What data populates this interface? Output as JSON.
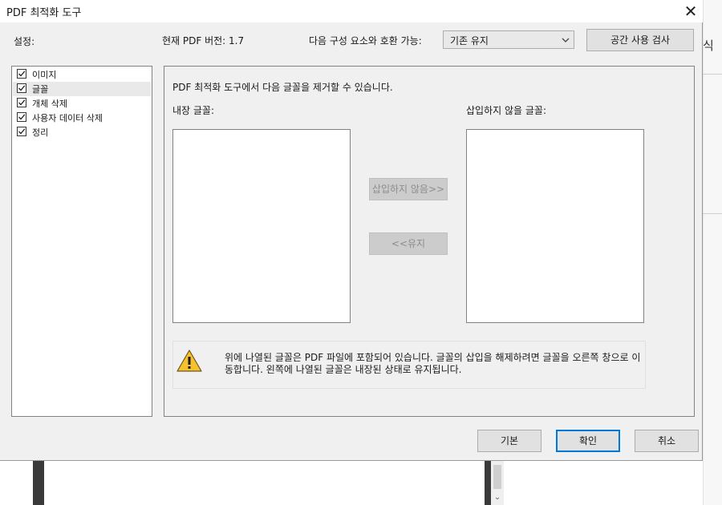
{
  "dialog": {
    "title": "PDF 최적화 도구",
    "close_symbol": "✕"
  },
  "header": {
    "settings_label": "설정:",
    "version_text": "현재 PDF 버전: 1.7",
    "compat_label": "다음 구성 요소와 호환 가능:",
    "compat_value": "기존 유지",
    "space_audit_label": "공간 사용 검사"
  },
  "settings_list": {
    "items": [
      {
        "label": "이미지",
        "checked": true,
        "selected": false
      },
      {
        "label": "글꼴",
        "checked": true,
        "selected": true
      },
      {
        "label": "개체 삭제",
        "checked": true,
        "selected": false
      },
      {
        "label": "사용자 데이터 삭제",
        "checked": true,
        "selected": false
      },
      {
        "label": "정리",
        "checked": true,
        "selected": false
      }
    ]
  },
  "fonts_panel": {
    "description": "PDF 최적화 도구에서 다음 글꼴을 제거할 수 있습니다.",
    "embedded_label": "내장 글꼴:",
    "not_embed_label": "삽입하지 않을 글꼴:",
    "unembed_button": "삽입하지 않음>>",
    "retain_button": "<<유지",
    "warning_text": "위에 나열된 글꼴은 PDF 파일에 포함되어 있습니다. 글꼴의 삽입을 해제하려면 글꼴을 오른쪽 창으로 이동합니다. 왼쪽에 나열된 글꼴은 내장된 상태로 유지됩니다.",
    "warning_icon": "warning-triangle-icon"
  },
  "footer": {
    "default_label": "기본",
    "ok_label": "확인",
    "cancel_label": "취소"
  },
  "background": {
    "right_text": "식"
  },
  "colors": {
    "dialog_bg": "#f0f0f0",
    "accent": "#0078d7",
    "warning_yellow": "#f6c02f"
  }
}
